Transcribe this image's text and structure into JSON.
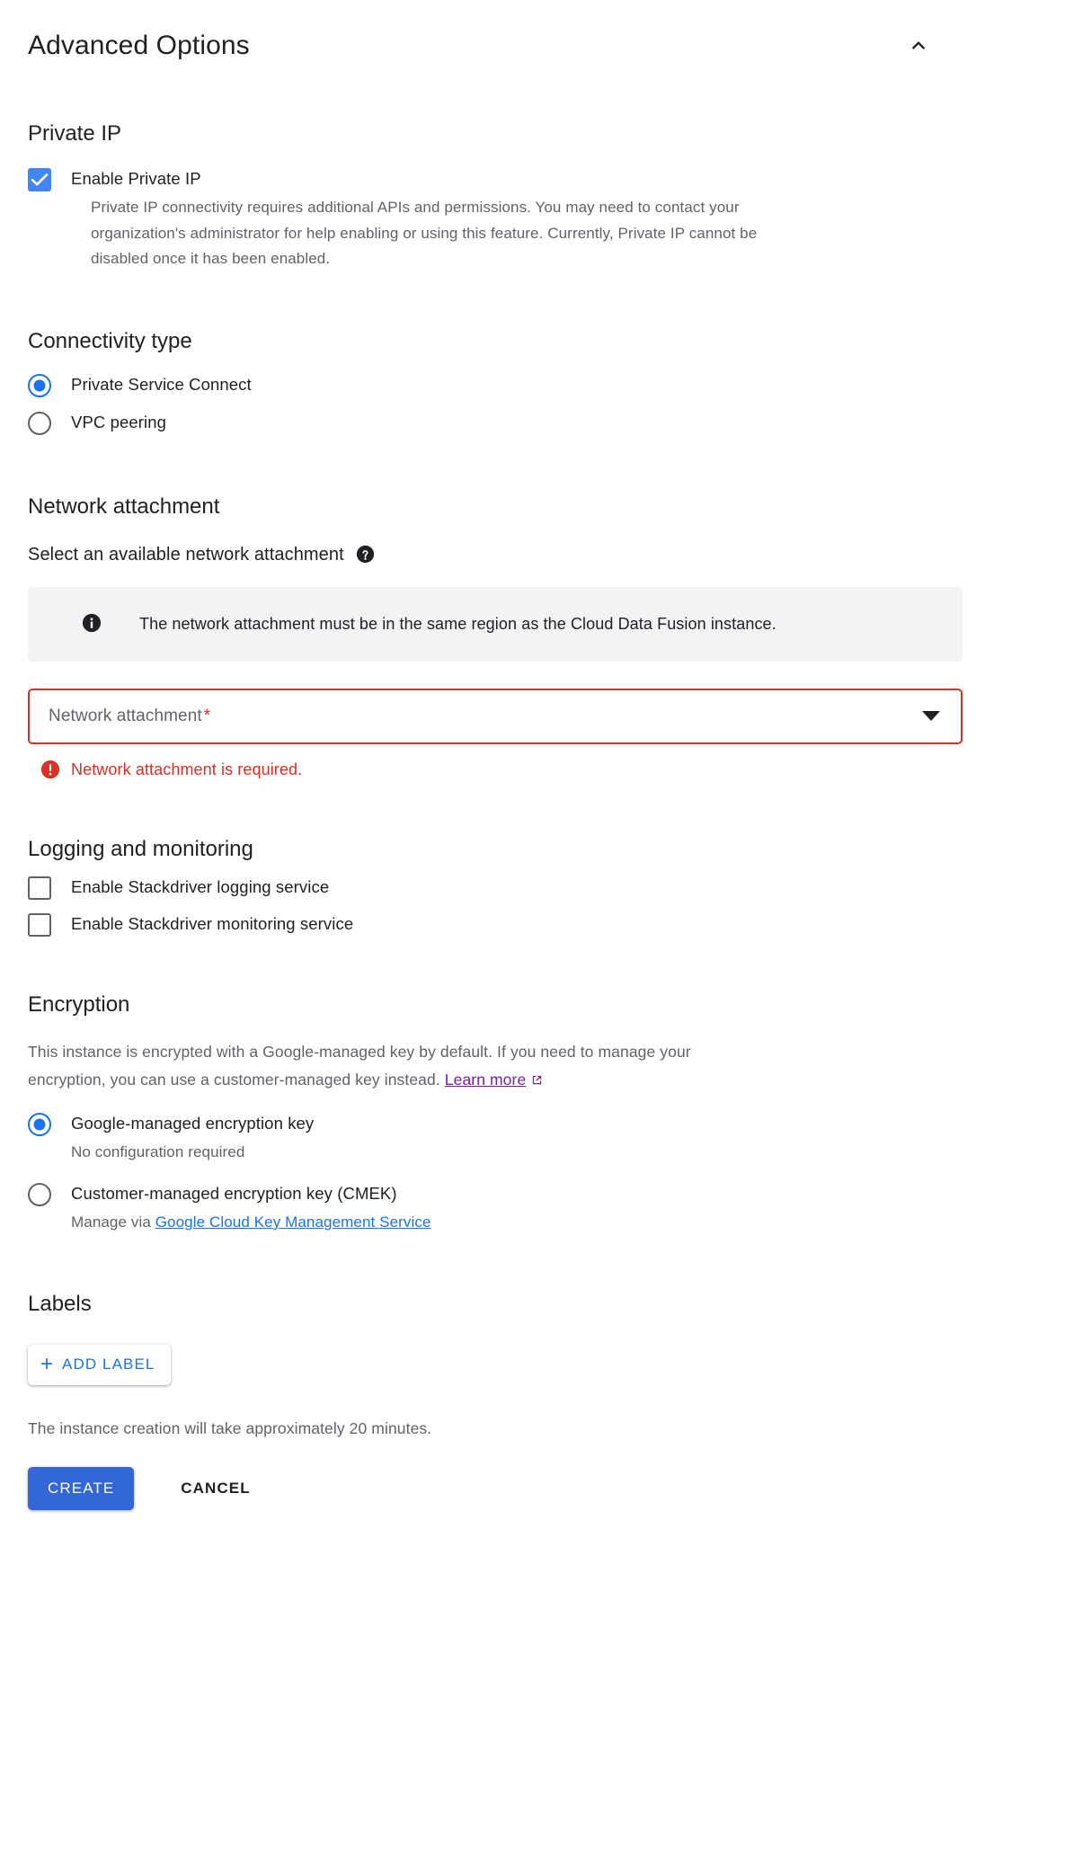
{
  "header": {
    "title": "Advanced Options",
    "collapse_icon": "chevron-up-icon"
  },
  "private_ip": {
    "heading": "Private IP",
    "checkbox": {
      "label": "Enable Private IP",
      "checked": true,
      "description": "Private IP connectivity requires additional APIs and permissions. You may need to contact your organization's administrator for help enabling or using this feature. Currently, Private IP cannot be disabled once it has been enabled."
    }
  },
  "connectivity": {
    "heading": "Connectivity type",
    "options": [
      {
        "label": "Private Service Connect",
        "selected": true
      },
      {
        "label": "VPC peering",
        "selected": false
      }
    ]
  },
  "network_attachment": {
    "heading": "Network attachment",
    "subtitle": "Select an available network attachment",
    "help_icon": "help-circle-icon",
    "info": {
      "icon": "info-circle-icon",
      "text": "The network attachment must be in the same region as the Cloud Data Fusion instance."
    },
    "select": {
      "placeholder": "Network attachment",
      "required_marker": "*",
      "value": "",
      "caret_icon": "caret-down-icon"
    },
    "error": {
      "icon": "error-circle-icon",
      "text": "Network attachment is required."
    }
  },
  "logging": {
    "heading": "Logging and monitoring",
    "checkboxes": [
      {
        "label": "Enable Stackdriver logging service",
        "checked": false
      },
      {
        "label": "Enable Stackdriver monitoring service",
        "checked": false
      }
    ]
  },
  "encryption": {
    "heading": "Encryption",
    "description_part1": "This instance is encrypted with a Google-managed key by default. If you need to manage your encryption, you can use a customer-managed key instead. ",
    "learn_more": "Learn more",
    "external_icon": "external-link-icon",
    "options": [
      {
        "label": "Google-managed encryption key",
        "sub": "No configuration required",
        "selected": true
      },
      {
        "label": "Customer-managed encryption key (CMEK)",
        "sub_prefix": "Manage via ",
        "sub_link": "Google Cloud Key Management Service",
        "selected": false
      }
    ]
  },
  "labels": {
    "heading": "Labels",
    "add_button": {
      "icon": "plus-icon",
      "label": "ADD LABEL"
    }
  },
  "footer": {
    "note": "The instance creation will take approximately 20 minutes.",
    "create_label": "CREATE",
    "cancel_label": "CANCEL"
  },
  "colors": {
    "accent_blue": "#1a73e8",
    "create_blue": "#3367d6",
    "checkbox_blue": "#4285f4",
    "error_red": "#d93025",
    "link_purple": "#7b1fa2",
    "info_bg": "#f1f3f4",
    "text_primary": "#202124",
    "text_secondary": "#5f6368"
  }
}
